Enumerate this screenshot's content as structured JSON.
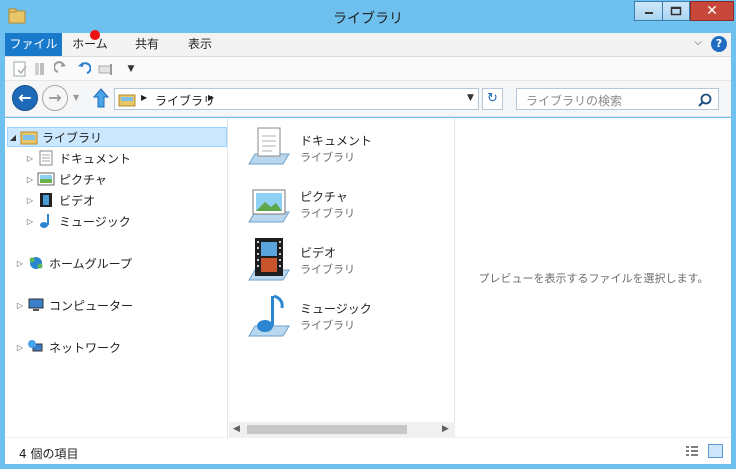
{
  "window": {
    "title": "ライブラリ"
  },
  "ribbon": {
    "tabs": [
      "ファイル",
      "ホーム",
      "共有",
      "表示"
    ]
  },
  "address": {
    "path": "ライブラリ",
    "search_placeholder": "ライブラリの検索"
  },
  "nav_tree": {
    "libraries": "ライブラリ",
    "children": [
      "ドキュメント",
      "ピクチャ",
      "ビデオ",
      "ミュージック"
    ],
    "homegroup": "ホームグループ",
    "computer": "コンピューター",
    "network": "ネットワーク"
  },
  "files": [
    {
      "name": "ドキュメント",
      "type": "ライブラリ",
      "icon": "documents-library-icon"
    },
    {
      "name": "ピクチャ",
      "type": "ライブラリ",
      "icon": "pictures-library-icon"
    },
    {
      "name": "ビデオ",
      "type": "ライブラリ",
      "icon": "videos-library-icon"
    },
    {
      "name": "ミュージック",
      "type": "ライブラリ",
      "icon": "music-library-icon"
    }
  ],
  "preview": {
    "message": "プレビューを表示するファイルを選択します。"
  },
  "status": {
    "item_count": "4 個の項目"
  },
  "colors": {
    "accent": "#1979ca",
    "frame": "#6ec0ee",
    "close": "#c7473b",
    "selection": "#cce8ff"
  }
}
